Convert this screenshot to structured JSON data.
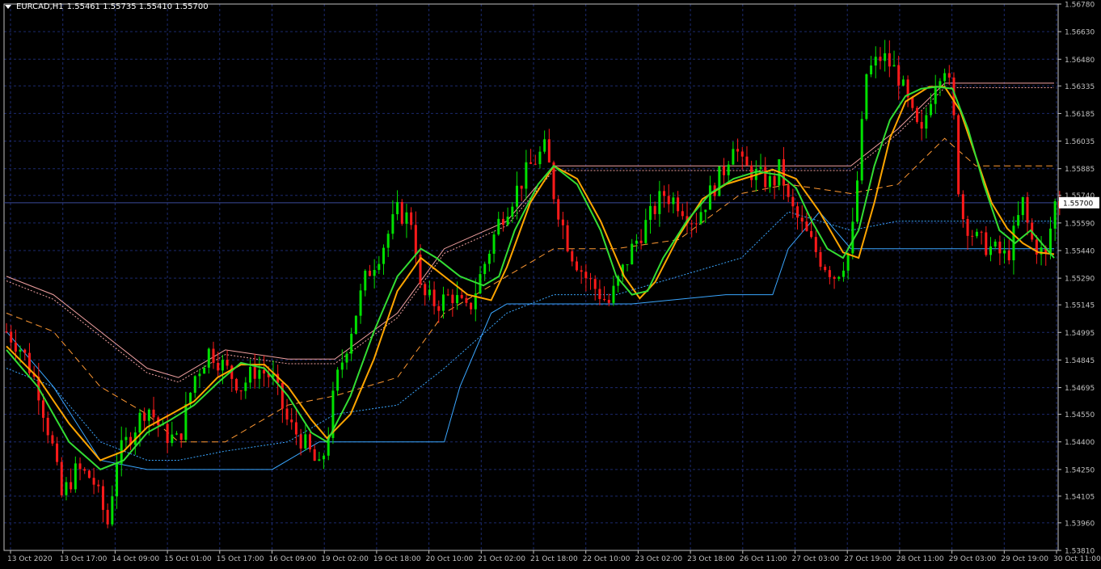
{
  "header": {
    "symbol": "EURCAD,H1",
    "ohlc": "1.55461 1.55735 1.55410 1.55700"
  },
  "colors": {
    "background": "#000000",
    "grid": "#1c2a6e",
    "axis": "#c0c0c0",
    "bull": "#00e000",
    "bear": "#ff1a1a",
    "ma_fast": "#33dd33",
    "ma_slow": "#ffa500",
    "band_outer_high": "#f0a0a0",
    "band_outer_low": "#3aa6ff",
    "band_mid_high": "#ff9933",
    "band_inner_low": "#3aa6ff",
    "price_line": "#3a4a9a"
  },
  "chart_data": {
    "type": "candlestick",
    "timeframe": "H1",
    "y_axis": {
      "min": 1.5381,
      "max": 1.5678,
      "ticks": [
        "1.56780",
        "1.56630",
        "1.56480",
        "1.56335",
        "1.56185",
        "1.56035",
        "1.55885",
        "1.55740",
        "1.55590",
        "1.55440",
        "1.55290",
        "1.55145",
        "1.54995",
        "1.54845",
        "1.54695",
        "1.54550",
        "1.54400",
        "1.54250",
        "1.54105",
        "1.53960",
        "1.53810"
      ]
    },
    "x_axis": {
      "labels": [
        "13 Oct 2020",
        "13 Oct 17:00",
        "14 Oct 09:00",
        "15 Oct 01:00",
        "15 Oct 17:00",
        "16 Oct 09:00",
        "19 Oct 02:00",
        "19 Oct 18:00",
        "20 Oct 10:00",
        "21 Oct 02:00",
        "21 Oct 18:00",
        "22 Oct 10:00",
        "23 Oct 02:00",
        "23 Oct 18:00",
        "26 Oct 11:00",
        "27 Oct 03:00",
        "27 Oct 19:00",
        "28 Oct 11:00",
        "29 Oct 03:00",
        "29 Oct 19:00",
        "30 Oct 11:00"
      ]
    },
    "current_price": "1.55700",
    "price_path": [
      [
        0,
        1.55
      ],
      [
        2,
        1.549
      ],
      [
        4,
        1.547
      ],
      [
        6,
        1.5435
      ],
      [
        7,
        1.541
      ],
      [
        9,
        1.5425
      ],
      [
        11,
        1.542
      ],
      [
        13,
        1.5395
      ],
      [
        14,
        1.543
      ],
      [
        16,
        1.5445
      ],
      [
        18,
        1.546
      ],
      [
        20,
        1.5445
      ],
      [
        22,
        1.544
      ],
      [
        24,
        1.5475
      ],
      [
        26,
        1.549
      ],
      [
        28,
        1.548
      ],
      [
        30,
        1.547
      ],
      [
        32,
        1.548
      ],
      [
        34,
        1.5475
      ],
      [
        36,
        1.545
      ],
      [
        38,
        1.544
      ],
      [
        40,
        1.5425
      ],
      [
        41,
        1.544
      ],
      [
        42,
        1.547
      ],
      [
        44,
        1.55
      ],
      [
        46,
        1.553
      ],
      [
        48,
        1.5545
      ],
      [
        50,
        1.5565
      ],
      [
        52,
        1.556
      ],
      [
        53,
        1.552
      ],
      [
        55,
        1.5515
      ],
      [
        57,
        1.552
      ],
      [
        59,
        1.551
      ],
      [
        61,
        1.5535
      ],
      [
        63,
        1.556
      ],
      [
        65,
        1.5575
      ],
      [
        67,
        1.559
      ],
      [
        69,
        1.56
      ],
      [
        70,
        1.5575
      ],
      [
        72,
        1.5545
      ],
      [
        74,
        1.553
      ],
      [
        76,
        1.552
      ],
      [
        77,
        1.5515
      ],
      [
        78,
        1.5525
      ],
      [
        80,
        1.5545
      ],
      [
        82,
        1.556
      ],
      [
        84,
        1.5575
      ],
      [
        86,
        1.557
      ],
      [
        88,
        1.556
      ],
      [
        90,
        1.5575
      ],
      [
        92,
        1.559
      ],
      [
        93,
        1.5605
      ],
      [
        94,
        1.559
      ],
      [
        96,
        1.5585
      ],
      [
        98,
        1.558
      ],
      [
        99,
        1.559
      ],
      [
        100,
        1.557
      ],
      [
        102,
        1.5555
      ],
      [
        104,
        1.554
      ],
      [
        106,
        1.553
      ],
      [
        108,
        1.5545
      ],
      [
        109,
        1.559
      ],
      [
        110,
        1.564
      ],
      [
        112,
        1.565
      ],
      [
        114,
        1.564
      ],
      [
        116,
        1.5615
      ],
      [
        117,
        1.5605
      ],
      [
        118,
        1.5625
      ],
      [
        119,
        1.564
      ],
      [
        120,
        1.5645
      ],
      [
        121,
        1.5625
      ],
      [
        122,
        1.5565
      ],
      [
        124,
        1.555
      ],
      [
        126,
        1.5545
      ],
      [
        128,
        1.554
      ],
      [
        130,
        1.557
      ],
      [
        131,
        1.555
      ],
      [
        133,
        1.554
      ],
      [
        134,
        1.557
      ]
    ],
    "ma_fast": [
      [
        0,
        1.549
      ],
      [
        4,
        1.547
      ],
      [
        8,
        1.544
      ],
      [
        12,
        1.5425
      ],
      [
        15,
        1.543
      ],
      [
        18,
        1.5445
      ],
      [
        21,
        1.5452
      ],
      [
        24,
        1.546
      ],
      [
        27,
        1.5472
      ],
      [
        30,
        1.5483
      ],
      [
        33,
        1.548
      ],
      [
        36,
        1.5465
      ],
      [
        39,
        1.5445
      ],
      [
        41,
        1.544
      ],
      [
        44,
        1.5465
      ],
      [
        47,
        1.55
      ],
      [
        50,
        1.553
      ],
      [
        53,
        1.5545
      ],
      [
        55,
        1.554
      ],
      [
        58,
        1.553
      ],
      [
        61,
        1.5525
      ],
      [
        63,
        1.553
      ],
      [
        65,
        1.5555
      ],
      [
        68,
        1.558
      ],
      [
        70,
        1.559
      ],
      [
        73,
        1.558
      ],
      [
        76,
        1.5555
      ],
      [
        78,
        1.553
      ],
      [
        80,
        1.552
      ],
      [
        82,
        1.5522
      ],
      [
        84,
        1.554
      ],
      [
        87,
        1.556
      ],
      [
        90,
        1.5575
      ],
      [
        93,
        1.5583
      ],
      [
        96,
        1.5587
      ],
      [
        99,
        1.5585
      ],
      [
        101,
        1.5578
      ],
      [
        103,
        1.556
      ],
      [
        105,
        1.5545
      ],
      [
        107,
        1.554
      ],
      [
        109,
        1.5555
      ],
      [
        111,
        1.559
      ],
      [
        113,
        1.5615
      ],
      [
        115,
        1.5628
      ],
      [
        117,
        1.5632
      ],
      [
        119,
        1.5633
      ],
      [
        121,
        1.5632
      ],
      [
        123,
        1.561
      ],
      [
        125,
        1.558
      ],
      [
        127,
        1.5555
      ],
      [
        129,
        1.5548
      ],
      [
        131,
        1.5555
      ],
      [
        133,
        1.5545
      ],
      [
        134,
        1.554
      ]
    ],
    "ma_slow": [
      [
        0,
        1.5492
      ],
      [
        4,
        1.5475
      ],
      [
        8,
        1.545
      ],
      [
        12,
        1.543
      ],
      [
        15,
        1.5435
      ],
      [
        18,
        1.5448
      ],
      [
        21,
        1.5455
      ],
      [
        24,
        1.5462
      ],
      [
        27,
        1.5475
      ],
      [
        30,
        1.5482
      ],
      [
        33,
        1.5482
      ],
      [
        36,
        1.547
      ],
      [
        39,
        1.5452
      ],
      [
        41,
        1.5442
      ],
      [
        44,
        1.5455
      ],
      [
        47,
        1.5485
      ],
      [
        50,
        1.5522
      ],
      [
        53,
        1.554
      ],
      [
        56,
        1.553
      ],
      [
        59,
        1.552
      ],
      [
        62,
        1.5517
      ],
      [
        64,
        1.5535
      ],
      [
        67,
        1.557
      ],
      [
        70,
        1.559
      ],
      [
        73,
        1.5583
      ],
      [
        76,
        1.556
      ],
      [
        79,
        1.553
      ],
      [
        81,
        1.5518
      ],
      [
        83,
        1.5527
      ],
      [
        86,
        1.5552
      ],
      [
        89,
        1.5572
      ],
      [
        92,
        1.558
      ],
      [
        95,
        1.5584
      ],
      [
        98,
        1.5588
      ],
      [
        101,
        1.5583
      ],
      [
        104,
        1.5565
      ],
      [
        107,
        1.5543
      ],
      [
        109,
        1.554
      ],
      [
        111,
        1.557
      ],
      [
        113,
        1.5605
      ],
      [
        115,
        1.5625
      ],
      [
        118,
        1.5633
      ],
      [
        120,
        1.5633
      ],
      [
        122,
        1.562
      ],
      [
        124,
        1.5595
      ],
      [
        126,
        1.557
      ],
      [
        128,
        1.5556
      ],
      [
        130,
        1.5548
      ],
      [
        132,
        1.5543
      ],
      [
        134,
        1.5542
      ]
    ],
    "band_outer_high": [
      [
        0,
        1.553
      ],
      [
        6,
        1.552
      ],
      [
        12,
        1.55
      ],
      [
        18,
        1.548
      ],
      [
        22,
        1.5475
      ],
      [
        28,
        1.549
      ],
      [
        36,
        1.5485
      ],
      [
        42,
        1.5485
      ],
      [
        50,
        1.551
      ],
      [
        56,
        1.5545
      ],
      [
        64,
        1.556
      ],
      [
        70,
        1.559
      ],
      [
        78,
        1.559
      ],
      [
        86,
        1.559
      ],
      [
        94,
        1.559
      ],
      [
        100,
        1.559
      ],
      [
        108,
        1.559
      ],
      [
        114,
        1.561
      ],
      [
        120,
        1.5635
      ],
      [
        124,
        1.5635
      ],
      [
        134,
        1.5635
      ]
    ],
    "band_mid_high": [
      [
        0,
        1.551
      ],
      [
        6,
        1.55
      ],
      [
        12,
        1.547
      ],
      [
        18,
        1.5455
      ],
      [
        22,
        1.544
      ],
      [
        28,
        1.544
      ],
      [
        36,
        1.546
      ],
      [
        42,
        1.5465
      ],
      [
        50,
        1.5475
      ],
      [
        56,
        1.551
      ],
      [
        64,
        1.553
      ],
      [
        70,
        1.5545
      ],
      [
        78,
        1.5545
      ],
      [
        86,
        1.555
      ],
      [
        94,
        1.5575
      ],
      [
        100,
        1.558
      ],
      [
        108,
        1.5575
      ],
      [
        114,
        1.558
      ],
      [
        120,
        1.5605
      ],
      [
        124,
        1.559
      ],
      [
        134,
        1.559
      ]
    ],
    "band_inner_low": [
      [
        0,
        1.548
      ],
      [
        6,
        1.547
      ],
      [
        12,
        1.544
      ],
      [
        18,
        1.543
      ],
      [
        22,
        1.543
      ],
      [
        28,
        1.5435
      ],
      [
        36,
        1.544
      ],
      [
        42,
        1.5455
      ],
      [
        50,
        1.546
      ],
      [
        56,
        1.548
      ],
      [
        64,
        1.551
      ],
      [
        70,
        1.552
      ],
      [
        78,
        1.552
      ],
      [
        86,
        1.553
      ],
      [
        94,
        1.554
      ],
      [
        100,
        1.5565
      ],
      [
        108,
        1.5555
      ],
      [
        114,
        1.556
      ],
      [
        120,
        1.556
      ],
      [
        124,
        1.556
      ],
      [
        134,
        1.556
      ]
    ],
    "band_outer_low": [
      [
        0,
        1.55
      ],
      [
        6,
        1.547
      ],
      [
        12,
        1.543
      ],
      [
        18,
        1.5425
      ],
      [
        22,
        1.5425
      ],
      [
        28,
        1.5425
      ],
      [
        34,
        1.5425
      ],
      [
        40,
        1.544
      ],
      [
        50,
        1.544
      ],
      [
        56,
        1.544
      ],
      [
        58,
        1.547
      ],
      [
        62,
        1.551
      ],
      [
        64,
        1.5515
      ],
      [
        72,
        1.5515
      ],
      [
        80,
        1.5515
      ],
      [
        92,
        1.552
      ],
      [
        98,
        1.552
      ],
      [
        100,
        1.5545
      ],
      [
        104,
        1.5565
      ],
      [
        108,
        1.5545
      ],
      [
        114,
        1.5545
      ],
      [
        120,
        1.5545
      ],
      [
        134,
        1.5545
      ]
    ]
  }
}
